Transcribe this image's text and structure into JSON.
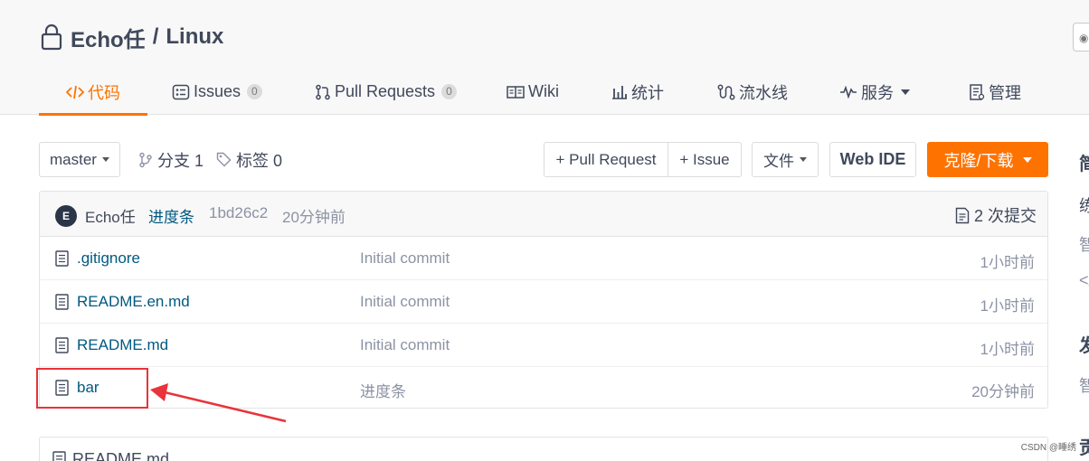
{
  "repo": {
    "owner": "Echo任",
    "separator": "/",
    "name": "Linux"
  },
  "tabs": [
    {
      "label": "代码",
      "icon": "code-icon",
      "active": true
    },
    {
      "label": "Issues",
      "icon": "issues-icon",
      "count": "0"
    },
    {
      "label": "Pull Requests",
      "icon": "pull-request-icon",
      "count": "0"
    },
    {
      "label": "Wiki",
      "icon": "wiki-icon"
    },
    {
      "label": "统计",
      "icon": "stats-icon"
    },
    {
      "label": "流水线",
      "icon": "pipeline-icon"
    },
    {
      "label": "服务",
      "icon": "service-icon",
      "dropdown": true
    },
    {
      "label": "管理",
      "icon": "manage-icon"
    }
  ],
  "toolbar": {
    "branch": "master",
    "branches": "分支 1",
    "tags": "标签 0",
    "pull_request": "+ Pull Request",
    "issue": "+ Issue",
    "files": "文件",
    "web_ide": "Web IDE",
    "clone": "克隆/下载"
  },
  "commit": {
    "avatar": "E",
    "author": "Echo任",
    "message": "进度条",
    "hash": "1bd26c2",
    "time": "20分钟前",
    "count": "2 次提交"
  },
  "files": [
    {
      "name": ".gitignore",
      "message": "Initial commit",
      "time": "1小时前"
    },
    {
      "name": "README.en.md",
      "message": "Initial commit",
      "time": "1小时前"
    },
    {
      "name": "README.md",
      "message": "Initial commit",
      "time": "1小时前"
    },
    {
      "name": "bar",
      "message": "进度条",
      "time": "20分钟前"
    }
  ],
  "readme": {
    "label": "README.md"
  },
  "sidebar_fragments": [
    "简",
    "练",
    "智",
    "</",
    "发",
    "智",
    "贡"
  ],
  "watermark": "CSDN @睡绣",
  "colors": {
    "accent": "#fe7300",
    "link": "#005980",
    "muted": "#8c92a4",
    "annotation": "#e8343a"
  }
}
